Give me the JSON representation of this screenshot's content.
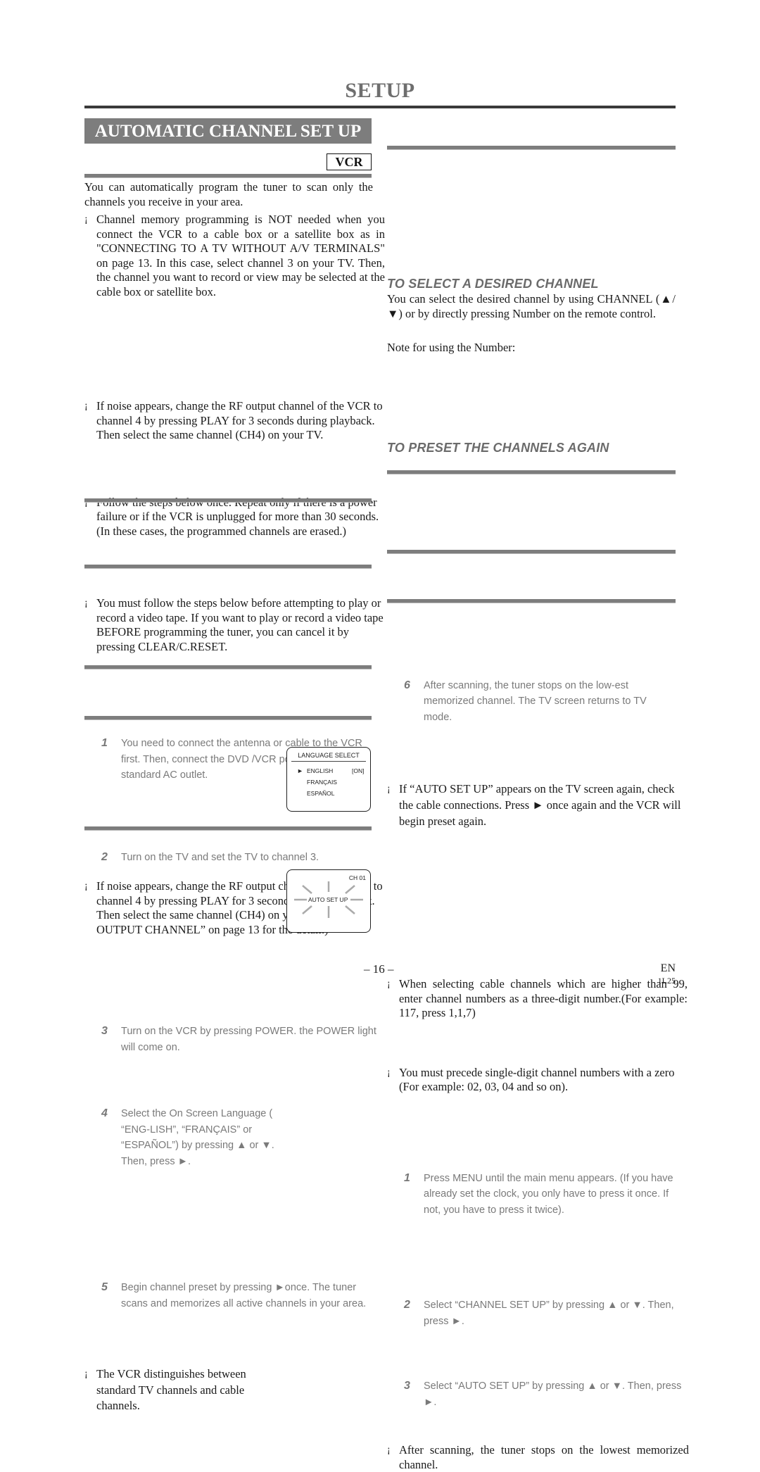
{
  "header": {
    "title": "SETUP",
    "section_title": "AUTOMATIC CHANNEL SET UP",
    "device_badge": "VCR"
  },
  "left": {
    "intro": "You can automatically program the tuner to scan only the channels you receive in your area.",
    "bullets": [
      "Channel memory programming is NOT needed when you connect the VCR to a cable box or a satellite box as in \"CONNECTING TO A TV WITHOUT A/V TERMINALS\" on page 13. In this case, select channel 3 on your TV. Then, the channel you want to record or view may be selected at the cable box or satellite box.",
      "If noise appears, change the RF output channel of the VCR to channel 4 by pressing PLAY for 3 seconds during playback.  Then select the same channel (CH4) on your TV.",
      "Follow the steps below once. Repeat only if there is a power failure or if the VCR is unplugged for more than 30 seconds. (In these cases, the programmed channels are erased.)",
      "You must follow the steps below before attempting to play or record a video tape. If you want to play or record a video tape BEFORE programming the tuner, you can cancel it by pressing CLEAR/C.RESET."
    ],
    "bullet_mark": "¡",
    "steps": [
      {
        "num": "1",
        "text": "You need to connect the antenna or cable to the VCR first. Then, connect the DVD /VCR power plug to a standard AC outlet."
      },
      {
        "num": "2",
        "text": "Turn on the TV and set the TV to channel 3."
      },
      {
        "num": "3",
        "text": "Turn on the VCR by pressing POWER. the POWER light will come on."
      },
      {
        "num": "4",
        "text": "Select the On Screen Language ( “ENG-LISH”, “FRANÇAIS” or “ESPAÑOL”) by pressing ▲ or ▼. Then, press ►."
      },
      {
        "num": "5",
        "text": "Begin channel preset by pressing ►once. The tuner scans and memorizes all active channels in your area."
      }
    ],
    "step2_note": "If noise appears, change the RF output channel of the VCR to channel 4 by pressing PLAY for 3 seconds during playback.  Then select the same channel (CH4) on your TV. (See “RF OUTPUT CHANNEL” on page 13 for the detail.)",
    "step5_note": "The VCR distinguishes between standard TV channels and cable channels."
  },
  "language_screen": {
    "title": "LANGUAGE SELECT",
    "cursor": "►",
    "options": [
      "ENGLISH",
      "FRANÇAIS",
      "ESPAÑOL"
    ],
    "selected_status": "[ON]"
  },
  "autosetup_screen": {
    "channel": "CH 01",
    "label": "AUTO SET UP"
  },
  "right": {
    "step6": {
      "num": "6",
      "text": "After scanning, the tuner stops on the low-est memorized channel. The TV screen returns to TV mode."
    },
    "step6_note": "If “AUTO SET UP” appears on the TV screen again, check the cable connections. Press ► once again and the VCR will begin preset again.",
    "select_channel": {
      "heading": "TO SELECT A DESIRED CHANNEL",
      "body": "You can select the desired channel by using CHANNEL (▲/▼) or by directly pressing Number on the remote control.",
      "note_label": "Note for using the Number:",
      "bullets": [
        "When selecting cable channels which are higher than 99, enter channel numbers as a three-digit number.(For example: 117, press 1,1,7)",
        "You must precede single-digit channel numbers with a zero (For example: 02, 03, 04 and so on)."
      ]
    },
    "preset_again": {
      "heading": "TO PRESET THE CHANNELS AGAIN",
      "steps": [
        {
          "num": "1",
          "text": "Press MENU until the main menu appears. (If you have already set the clock, you only have to press it once. If not, you have to press it twice)."
        },
        {
          "num": "2",
          "text": "Select “CHANNEL SET UP” by pressing ▲ or ▼. Then, press ►."
        },
        {
          "num": "3",
          "text": "Select “AUTO SET UP” by pressing ▲ or ▼. Then, press ►."
        }
      ],
      "final_note": "After scanning, the tuner stops on the lowest memorized channel."
    }
  },
  "footer": {
    "page_number": "– 16 –",
    "language": "EN",
    "code": "1L25"
  }
}
